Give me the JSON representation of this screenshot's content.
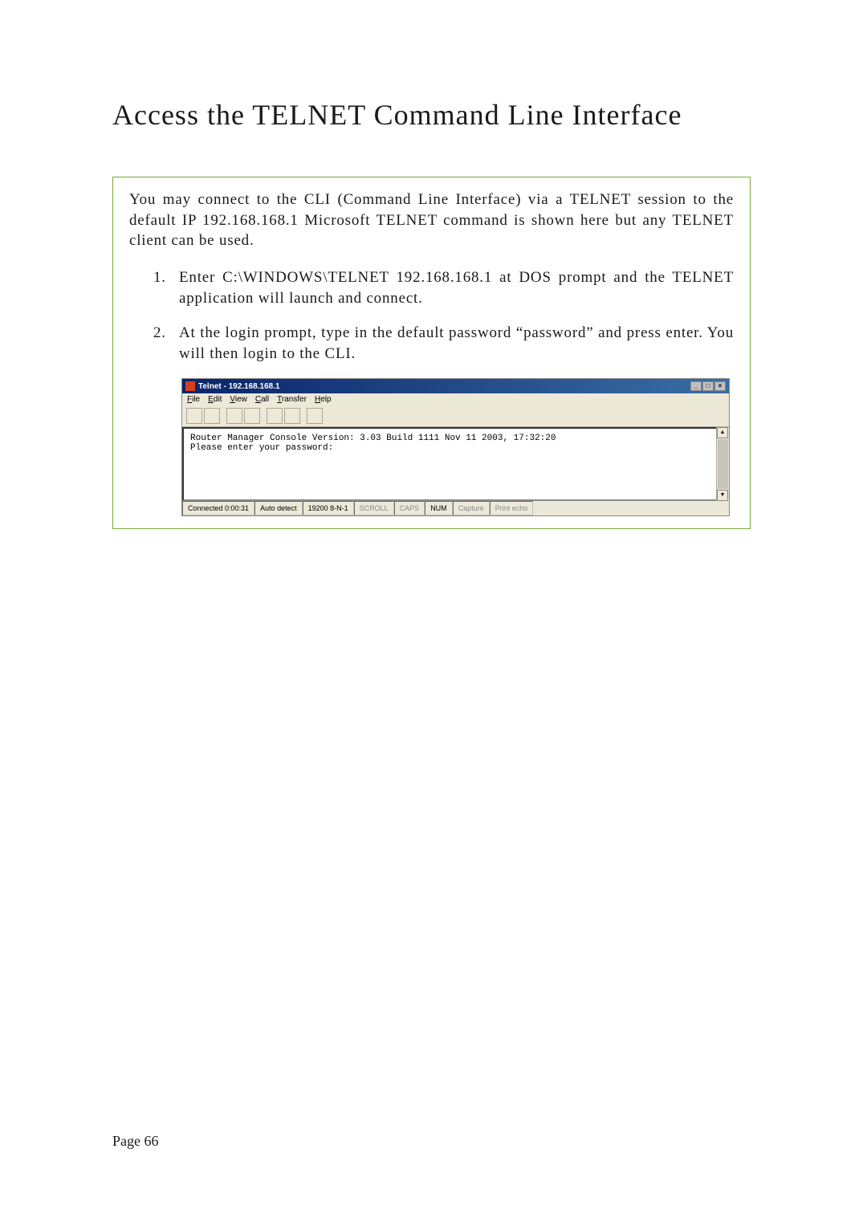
{
  "heading": "Access the TELNET Command Line Interface",
  "intro": "You may connect to the CLI (Command Line Interface) via a TELNET session to the default IP 192.168.168.1 Microsoft TELNET command is shown here but any TELNET client can be used.",
  "steps": [
    "Enter C:\\WINDOWS\\TELNET 192.168.168.1 at DOS prompt and the TELNET application will launch and connect.",
    "At the login prompt, type in the default password “password” and press enter. You will then login to the CLI."
  ],
  "telnet_window": {
    "title": "Telnet - 192.168.168.1",
    "menus": [
      "File",
      "Edit",
      "View",
      "Call",
      "Transfer",
      "Help"
    ],
    "terminal_lines": [
      "Router Manager Console Version: 3.03 Build 1111 Nov 11 2003, 17:32:20",
      "Please enter your password:"
    ],
    "status": {
      "connected": "Connected 0:00:31",
      "detect": "Auto detect",
      "config": "19200 8-N-1",
      "scroll": "SCROLL",
      "caps": "CAPS",
      "num": "NUM",
      "capture": "Capture",
      "printecho": "Print echo"
    }
  },
  "page_number": "Page 66"
}
